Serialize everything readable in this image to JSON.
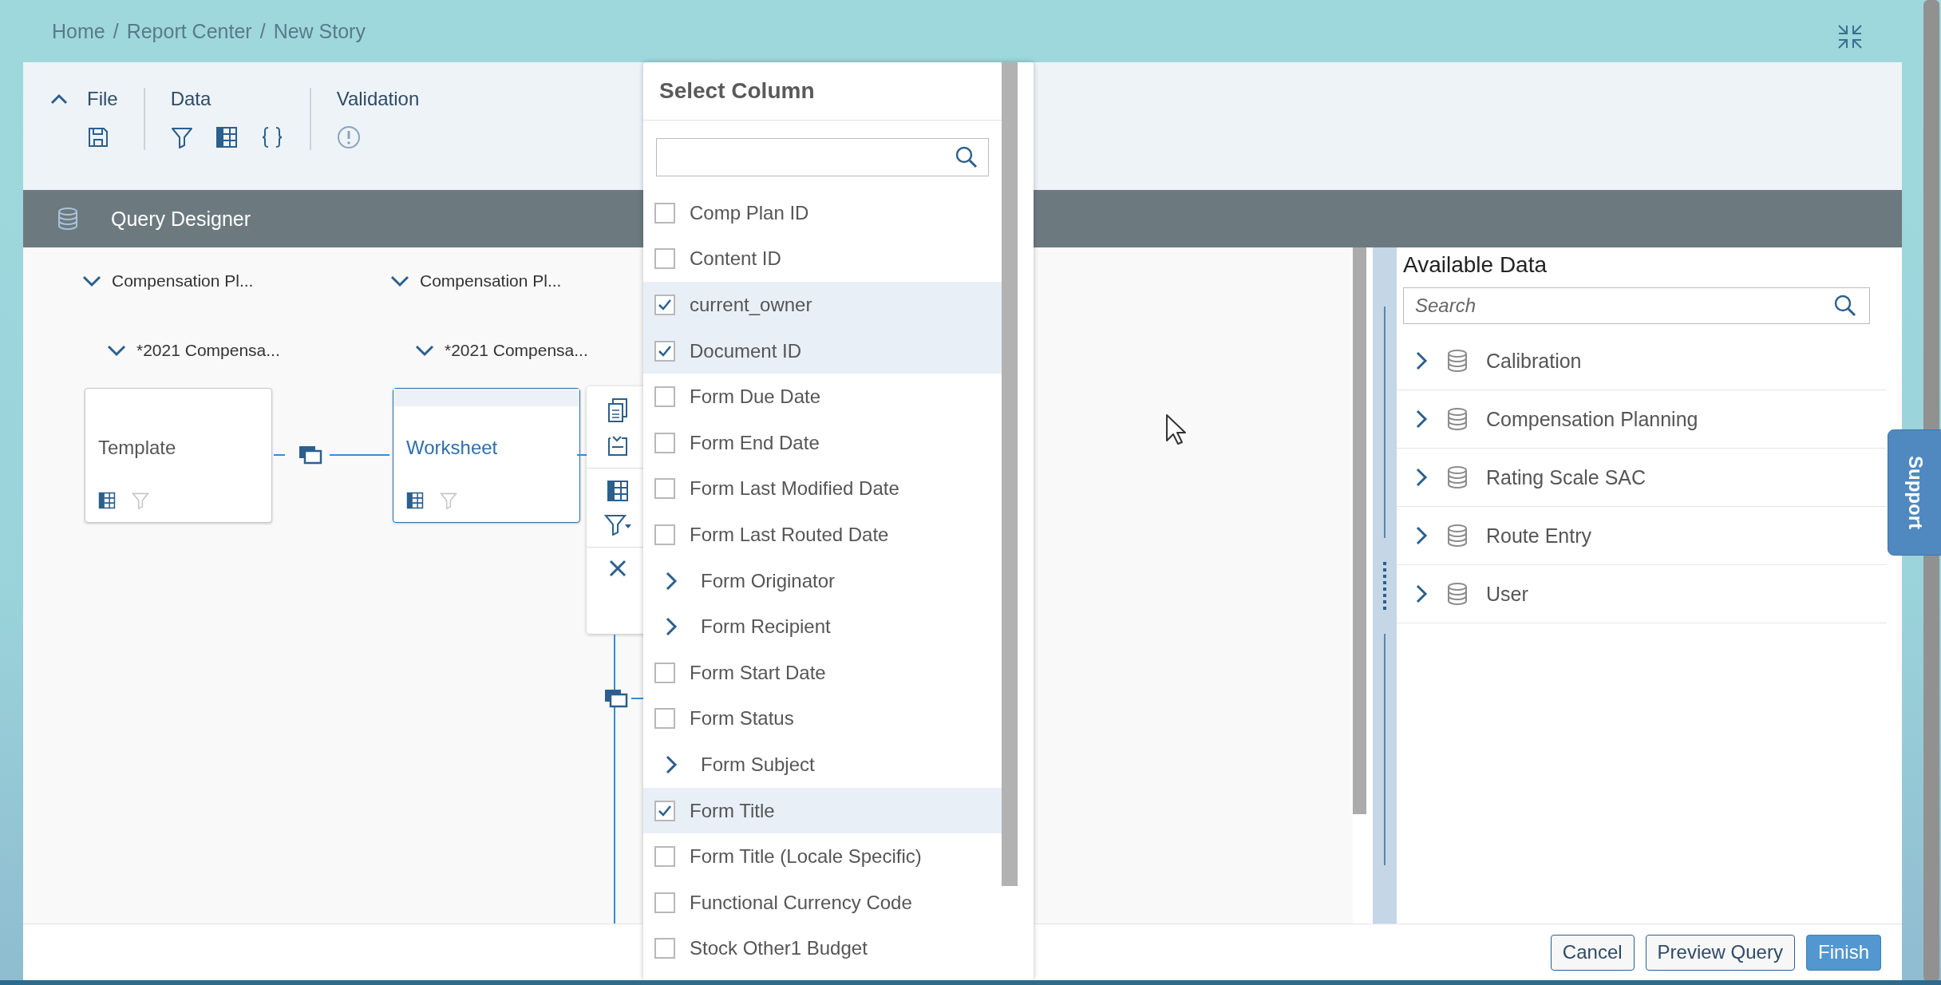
{
  "breadcrumb": {
    "separator": "/",
    "items": [
      "Home",
      "Report Center",
      "New Story"
    ]
  },
  "toolbar": {
    "groups": [
      {
        "label": "File",
        "tools": [
          {
            "kind": "save"
          }
        ]
      },
      {
        "label": "Data",
        "tools": [
          {
            "kind": "filter"
          },
          {
            "kind": "table"
          },
          {
            "kind": "braces"
          }
        ]
      },
      {
        "label": "Validation",
        "tools": [
          {
            "kind": "warning"
          }
        ]
      }
    ]
  },
  "header": {
    "title": "Query Designer"
  },
  "canvas": {
    "nodes": [
      {
        "group": "Compensation Pl...",
        "subgroup": "*2021 Compensa...",
        "label": "Template",
        "selected": false
      },
      {
        "group": "Compensation Pl...",
        "subgroup": "*2021 Compensa...",
        "label": "Worksheet",
        "selected": true
      }
    ]
  },
  "select_column": {
    "title": "Select Column",
    "items": [
      {
        "kind": "checkbox",
        "label": "Comp Plan ID",
        "checked": false
      },
      {
        "kind": "checkbox",
        "label": "Content ID",
        "checked": false
      },
      {
        "kind": "checkbox",
        "label": "current_owner",
        "checked": true
      },
      {
        "kind": "checkbox",
        "label": "Document ID",
        "checked": true
      },
      {
        "kind": "checkbox",
        "label": "Form Due Date",
        "checked": false
      },
      {
        "kind": "checkbox",
        "label": "Form End Date",
        "checked": false
      },
      {
        "kind": "checkbox",
        "label": "Form Last Modified Date",
        "checked": false
      },
      {
        "kind": "checkbox",
        "label": "Form Last Routed Date",
        "checked": false
      },
      {
        "kind": "group",
        "label": "Form Originator",
        "expanded": false
      },
      {
        "kind": "group",
        "label": "Form Recipient",
        "expanded": false
      },
      {
        "kind": "checkbox",
        "label": "Form Start Date",
        "checked": false
      },
      {
        "kind": "checkbox",
        "label": "Form Status",
        "checked": false
      },
      {
        "kind": "group",
        "label": "Form Subject",
        "expanded": false
      },
      {
        "kind": "checkbox",
        "label": "Form Title",
        "checked": true
      },
      {
        "kind": "checkbox",
        "label": "Form Title (Locale Specific)",
        "checked": false
      },
      {
        "kind": "checkbox",
        "label": "Functional Currency Code",
        "checked": false
      },
      {
        "kind": "checkbox",
        "label": "Stock Other1 Budget",
        "checked": false
      }
    ]
  },
  "available_data": {
    "title": "Available Data",
    "search": {
      "placeholder": "Search"
    },
    "items": [
      {
        "label": "Calibration",
        "expanded": false
      },
      {
        "label": "Compensation Planning",
        "expanded": false
      },
      {
        "label": "Rating Scale SAC",
        "expanded": false
      },
      {
        "label": "Route Entry",
        "expanded": false
      },
      {
        "label": "User",
        "expanded": false
      }
    ]
  },
  "support": {
    "label": "Support"
  },
  "footer": {
    "buttons": [
      {
        "label": "Cancel",
        "kind": "secondary"
      },
      {
        "label": "Preview Query",
        "kind": "secondary"
      },
      {
        "label": "Finish",
        "kind": "primary"
      }
    ]
  }
}
